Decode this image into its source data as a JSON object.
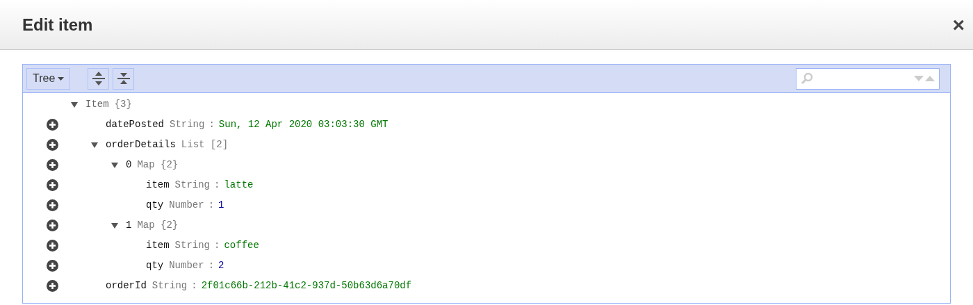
{
  "window": {
    "title": "Edit item",
    "close": "×"
  },
  "toolbar": {
    "mode_button": "Tree"
  },
  "tree": [
    {
      "key": "Item",
      "type": "{3}",
      "expanded": true,
      "addable": false,
      "children": [
        {
          "key": "datePosted",
          "type": "String",
          "separator": ":",
          "value": "Sun, 12 Apr 2020 03:03:30 GMT",
          "kind": "string",
          "addable": true
        },
        {
          "key": "orderDetails",
          "type": "List [2]",
          "expanded": true,
          "addable": true,
          "children": [
            {
              "key": "0",
              "type": "Map {2}",
              "expanded": true,
              "addable": true,
              "children": [
                {
                  "key": "item",
                  "type": "String",
                  "separator": ":",
                  "value": "latte",
                  "kind": "string",
                  "addable": true
                },
                {
                  "key": "qty",
                  "type": "Number",
                  "separator": ":",
                  "value": "1",
                  "kind": "number",
                  "addable": true
                }
              ]
            },
            {
              "key": "1",
              "type": "Map {2}",
              "expanded": true,
              "addable": true,
              "children": [
                {
                  "key": "item",
                  "type": "String",
                  "separator": ":",
                  "value": "coffee",
                  "kind": "string",
                  "addable": true
                },
                {
                  "key": "qty",
                  "type": "Number",
                  "separator": ":",
                  "value": "2",
                  "kind": "number",
                  "addable": true
                }
              ]
            }
          ]
        },
        {
          "key": "orderId",
          "type": "String",
          "separator": ":",
          "value": "2f01c66b-212b-41c2-937d-50b63d6a70df",
          "kind": "string",
          "addable": true
        }
      ]
    }
  ]
}
